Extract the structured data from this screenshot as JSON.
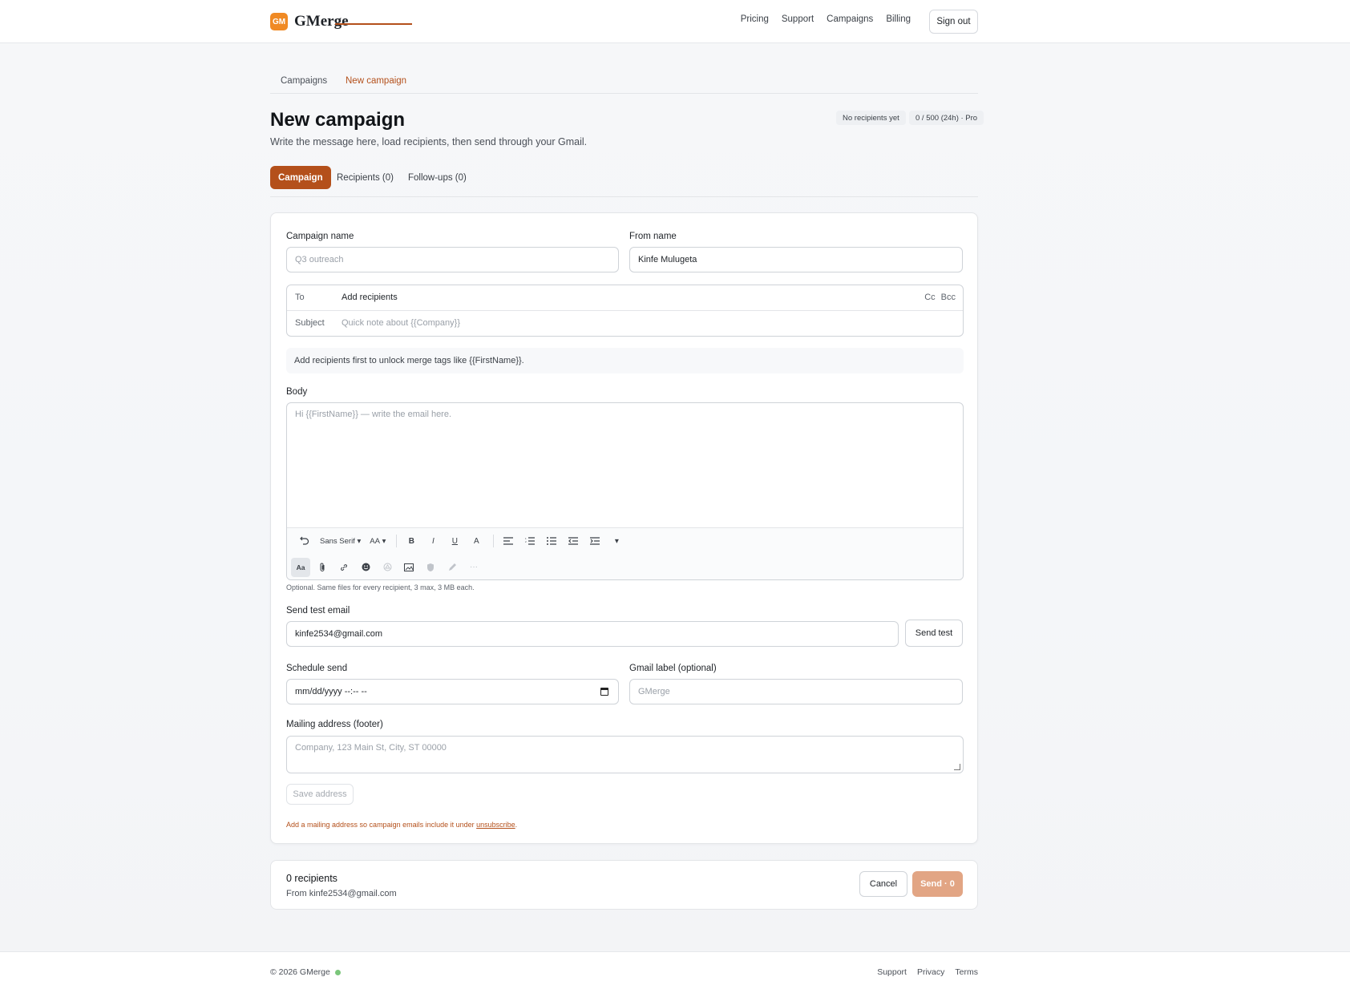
{
  "brand": {
    "logo_text": "GM",
    "name": "GMerge",
    "accent": "#f08a24"
  },
  "nav": {
    "links": [
      "Pricing",
      "Support",
      "Campaigns",
      "Billing"
    ],
    "sign_out": "Sign out"
  },
  "page_tabs": [
    "Campaigns",
    "New campaign"
  ],
  "header": {
    "title": "New campaign",
    "subtitle": "Write the message here, load recipients, then send through your Gmail.",
    "recipients_pill": "No recipients yet",
    "quota_pill": "0 / 500 (24h) · Pro"
  },
  "section_tabs": [
    "Campaign",
    "Recipients (0)",
    "Follow-ups (0)"
  ],
  "form": {
    "campaign_name_label": "Campaign name",
    "campaign_name_placeholder": "Q3 outreach",
    "from_name_label": "From name",
    "from_name_value": "Kinfe Mulugeta",
    "to_label": "To",
    "to_value": "Add recipients",
    "cc": "Cc",
    "bcc": "Bcc",
    "subject_label": "Subject",
    "subject_placeholder": "Quick note about {{Company}}",
    "notice": "Add recipients first to unlock merge tags like {{FirstName}}.",
    "body_label": "Body",
    "body_placeholder": "Hi {{FirstName}} — write the email here.",
    "toolbar": {
      "font": "Sans Serif",
      "size": "AA",
      "bold": "B",
      "italic": "I",
      "underline": "U",
      "color": "A",
      "format": "Aa"
    },
    "attach_hint": "Optional. Same files for every recipient, 3 max, 3 MB each.",
    "test_label": "Send test email",
    "test_value": "kinfe2534@gmail.com",
    "send_test": "Send test",
    "schedule_label": "Schedule send",
    "schedule_value": "mm/dd/yyyy --:-- --",
    "gmail_label_label": "Gmail label (optional)",
    "gmail_label_placeholder": "GMerge",
    "mailing_label": "Mailing address (footer)",
    "mailing_placeholder": "Company, 123 Main St, City, ST 00000",
    "save_address": "Save address",
    "warn_prefix": "Add a mailing address so campaign emails include it under ",
    "warn_link": "unsubscribe",
    "warn_suffix": "."
  },
  "sendbar": {
    "count": "0 recipients",
    "from": "From kinfe2534@gmail.com",
    "cancel": "Cancel",
    "send": "Send · 0"
  },
  "footer": {
    "copyright": "© 2026 GMerge",
    "links": [
      "Support",
      "Privacy",
      "Terms"
    ]
  }
}
